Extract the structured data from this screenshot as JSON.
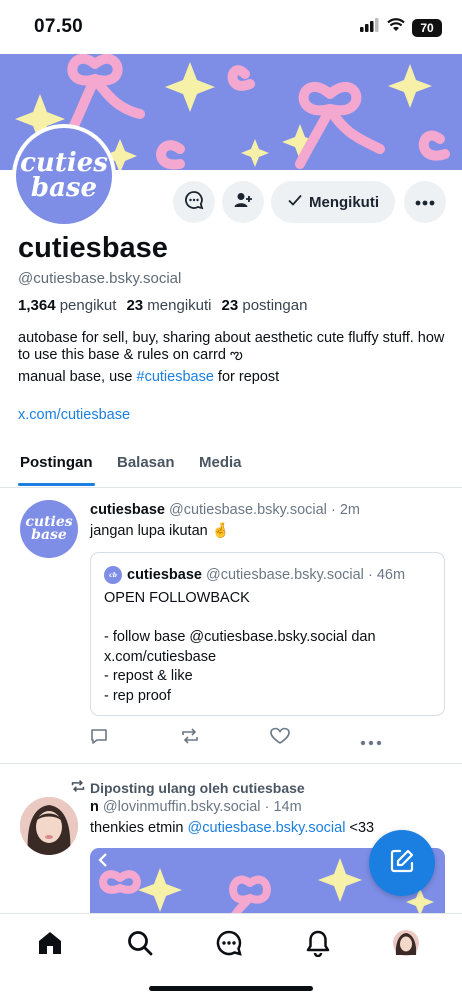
{
  "status_bar": {
    "time": "07.50",
    "battery": "70"
  },
  "profile": {
    "avatar_line1": "cuties",
    "avatar_line2": "base",
    "follow_label": "Mengikuti",
    "display_name": "cutiesbase",
    "handle": "@cutiesbase.bsky.social",
    "followers_count": "1,364",
    "followers_label": "pengikut",
    "following_count": "23",
    "following_label": "mengikuti",
    "posts_count": "23",
    "posts_label": "postingan",
    "bio_line1": "autobase for sell, buy, sharing about aesthetic cute fluffy stuff. how to use this base & rules on carrd ఌ",
    "bio_line2_prefix": "manual base, use ",
    "bio_hashtag": "#cutiesbase",
    "bio_line2_suffix": " for repost",
    "link": "x.com/cutiesbase"
  },
  "tabs": [
    {
      "label": "Postingan",
      "active": true
    },
    {
      "label": "Balasan",
      "active": false
    },
    {
      "label": "Media",
      "active": false
    }
  ],
  "post1": {
    "name": "cutiesbase",
    "handle": "@cutiesbase.bsky.social",
    "time": "2m",
    "text": "jangan lupa ikutan 🤞",
    "quote": {
      "name": "cutiesbase",
      "handle": "@cutiesbase.bsky.social",
      "time": "46m",
      "line1": "OPEN FOLLOWBACK",
      "line2": "- follow base @cutiesbase.bsky.social dan",
      "line3": "x.com/cutiesbase",
      "line4": "- repost & like",
      "line5": "- rep proof"
    }
  },
  "post2": {
    "repost_label": "Diposting ulang oleh cutiesbase",
    "name": "n",
    "handle": "@lovinmuffin.bsky.social",
    "time": "14m",
    "text_prefix": "thenkies etmin ",
    "text_mention": "@cutiesbase.bsky.social",
    "text_suffix": " <33"
  },
  "colors": {
    "accent": "#1a7fe0",
    "banner_bg": "#7e8ee6",
    "banner_bow": "#f4a8d0",
    "banner_star": "#f7f0a8"
  },
  "icons": {
    "message": "message-icon",
    "add_user": "add-user-icon",
    "more": "more-icon",
    "home": "home-icon",
    "search": "search-icon",
    "chat": "chat-icon",
    "bell": "bell-icon",
    "compose": "compose-icon"
  }
}
